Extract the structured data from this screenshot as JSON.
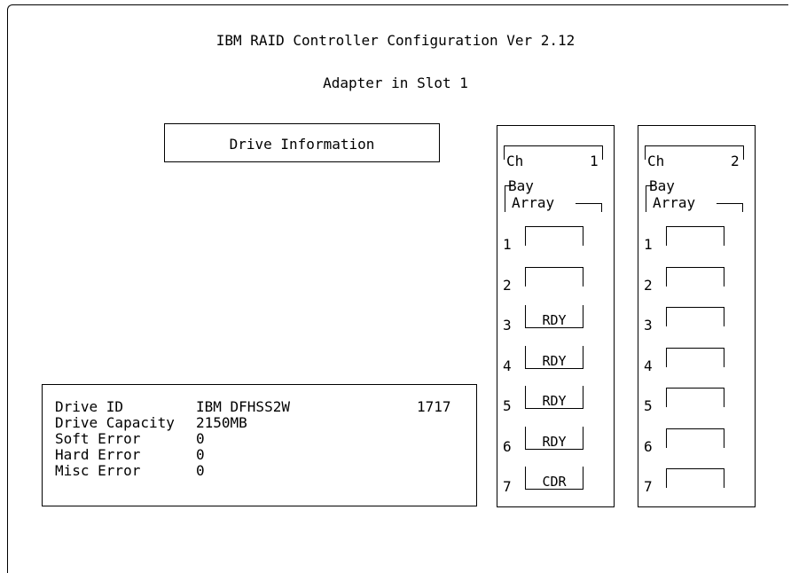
{
  "title": "IBM RAID Controller Configuration Ver 2.12",
  "subtitle": "Adapter in Slot 1",
  "panel_title": "Drive Information",
  "drive_info": {
    "rows": [
      {
        "label": "Drive ID",
        "value": "IBM DFHSS2W",
        "extra": "1717"
      },
      {
        "label": "Drive Capacity",
        "value": "2150MB",
        "extra": ""
      },
      {
        "label": "Soft Error",
        "value": "0",
        "extra": ""
      },
      {
        "label": "Hard Error",
        "value": "0",
        "extra": ""
      },
      {
        "label": "Misc Error",
        "value": "0",
        "extra": ""
      }
    ]
  },
  "channels": [
    {
      "ch_label": "Ch",
      "ch_num": "1",
      "bay_label": "Bay",
      "array_label": "Array",
      "bays": [
        {
          "num": "1",
          "status": ""
        },
        {
          "num": "2",
          "status": ""
        },
        {
          "num": "3",
          "status": "RDY"
        },
        {
          "num": "4",
          "status": "RDY"
        },
        {
          "num": "5",
          "status": "RDY"
        },
        {
          "num": "6",
          "status": "RDY"
        },
        {
          "num": "7",
          "status": "CDR"
        }
      ]
    },
    {
      "ch_label": "Ch",
      "ch_num": "2",
      "bay_label": "Bay",
      "array_label": "Array",
      "bays": [
        {
          "num": "1",
          "status": ""
        },
        {
          "num": "2",
          "status": ""
        },
        {
          "num": "3",
          "status": ""
        },
        {
          "num": "4",
          "status": ""
        },
        {
          "num": "5",
          "status": ""
        },
        {
          "num": "6",
          "status": ""
        },
        {
          "num": "7",
          "status": ""
        }
      ]
    }
  ]
}
